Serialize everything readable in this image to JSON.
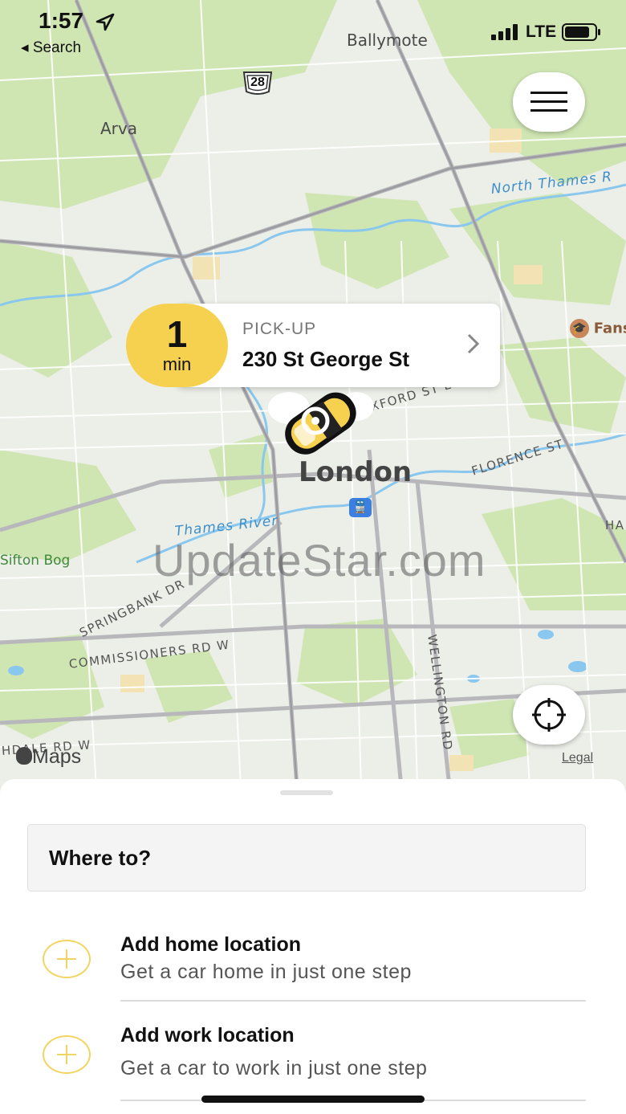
{
  "status": {
    "time": "1:57",
    "back_label": "◂ Search",
    "network": "LTE"
  },
  "map": {
    "places": {
      "ballymote": "Ballymote",
      "arva": "Arva",
      "london": "London",
      "fans": "Fans",
      "sifton": "Sifton Bog"
    },
    "highway_shield": "28",
    "water": {
      "north_thames": "North Thames R",
      "thames": "Thames River"
    },
    "streets": {
      "oxford": "XFORD ST E",
      "florence": "FLORENCE ST",
      "springbank": "SPRINGBANK DR",
      "commissioners": "COMMISSIONERS RD W",
      "wellington": "WELLINGTON RD",
      "southdale": "HDALE RD W",
      "ha": "HA"
    },
    "attribution": "Maps",
    "legal": "Legal"
  },
  "pickup": {
    "eta_value": "1",
    "eta_unit": "min",
    "label": "PICK-UP",
    "address": "230 St George St"
  },
  "watermark": "UpdateStar.com",
  "sheet": {
    "search_placeholder": "Where to?",
    "shortcuts": [
      {
        "title": "Add home location",
        "subtitle": "Get a car home in just one step"
      },
      {
        "title": "Add work location",
        "subtitle": "Get a car to work in just one step"
      }
    ]
  },
  "colors": {
    "accent": "#f6d14f",
    "park": "#c9e3ad",
    "water": "#8ac7ee",
    "map_bg": "#e9eae6"
  }
}
